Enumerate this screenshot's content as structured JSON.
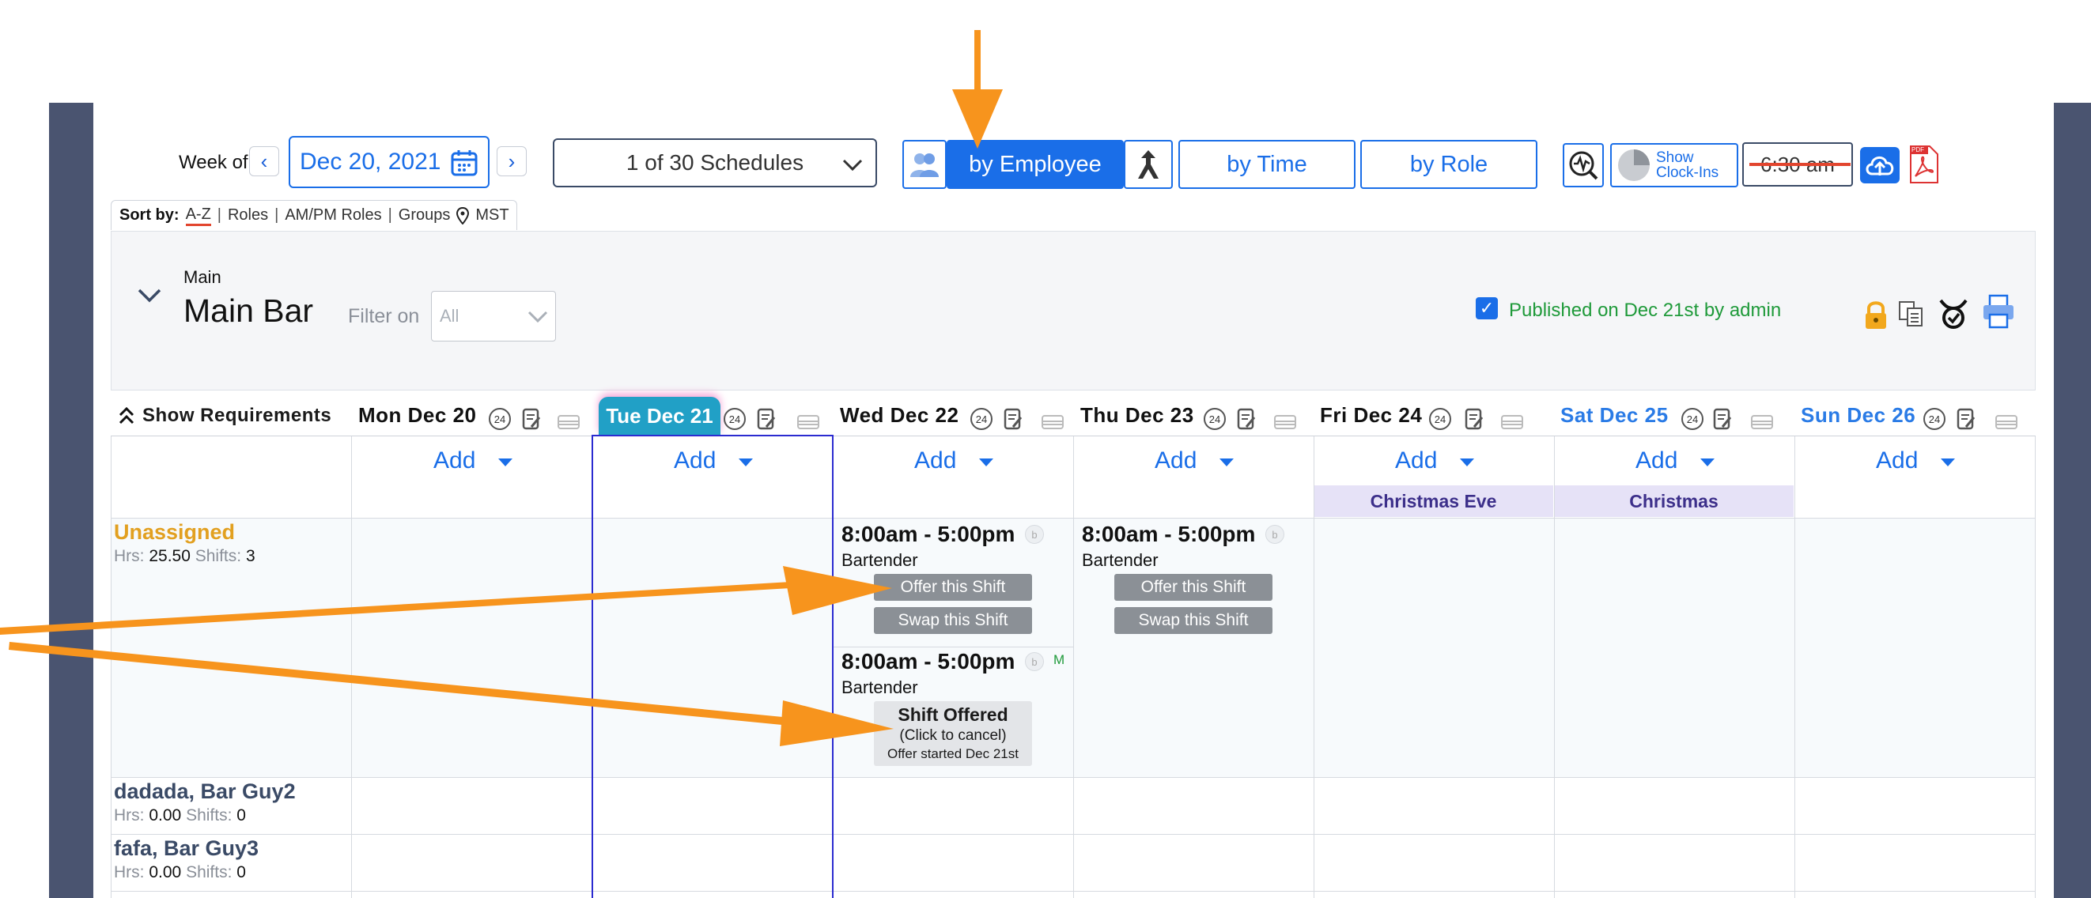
{
  "header": {
    "week_of_label": "Week of",
    "date": "Dec 20, 2021",
    "schedules": "1 of 30 Schedules",
    "views": {
      "employee": "by Employee",
      "time": "by Time",
      "role": "by Role"
    },
    "show_clockins": "Show\nClock-Ins",
    "time": "6:30 am",
    "pdf_badge": "PDF"
  },
  "sort": {
    "label": "Sort by:",
    "options": [
      "A-Z",
      "Roles",
      "AM/PM Roles",
      "Groups"
    ],
    "timezone": "MST"
  },
  "location": {
    "parent": "Main",
    "name": "Main Bar",
    "filter_label": "Filter on",
    "filter_value": "All",
    "published": "Published on Dec 21st by admin"
  },
  "grid": {
    "show_requirements": "Show Requirements",
    "days": [
      "Mon Dec 20",
      "Tue Dec 21",
      "Wed Dec 22",
      "Thu Dec 23",
      "Fri Dec 24",
      "Sat Dec 25",
      "Sun Dec 26"
    ],
    "today_index": 1,
    "badge_24": "24",
    "add_label": "Add",
    "holidays": {
      "fri": "Christmas Eve",
      "sat": "Christmas"
    }
  },
  "employees": [
    {
      "name": "Unassigned",
      "hrs_label": "Hrs:",
      "hrs": "25.50",
      "shifts_label": "Shifts:",
      "shifts": "3"
    },
    {
      "name": "dadada, Bar Guy2",
      "hrs_label": "Hrs:",
      "hrs": "0.00",
      "shifts_label": "Shifts:",
      "shifts": "0"
    },
    {
      "name": "fafa, Bar Guy3",
      "hrs_label": "Hrs:",
      "hrs": "0.00",
      "shifts_label": "Shifts:",
      "shifts": "0"
    }
  ],
  "shifts": {
    "wed1": {
      "time": "8:00am - 5:00pm",
      "role": "Bartender",
      "offer": "Offer this Shift",
      "swap": "Swap this Shift",
      "badge": "b"
    },
    "wed2": {
      "time": "8:00am - 5:00pm",
      "role": "Bartender",
      "badge": "b",
      "mark": "M",
      "offered_title": "Shift Offered",
      "offered_sub": "(Click to cancel)",
      "offered_note": "Offer started Dec 21st"
    },
    "thu1": {
      "time": "8:00am - 5:00pm",
      "role": "Bartender",
      "offer": "Offer this Shift",
      "swap": "Swap this Shift",
      "badge": "b"
    }
  },
  "colors": {
    "accent": "#1a6ee8",
    "annotation": "#f7941d",
    "sidebar": "#4a5470",
    "today": "#21a0c6"
  }
}
